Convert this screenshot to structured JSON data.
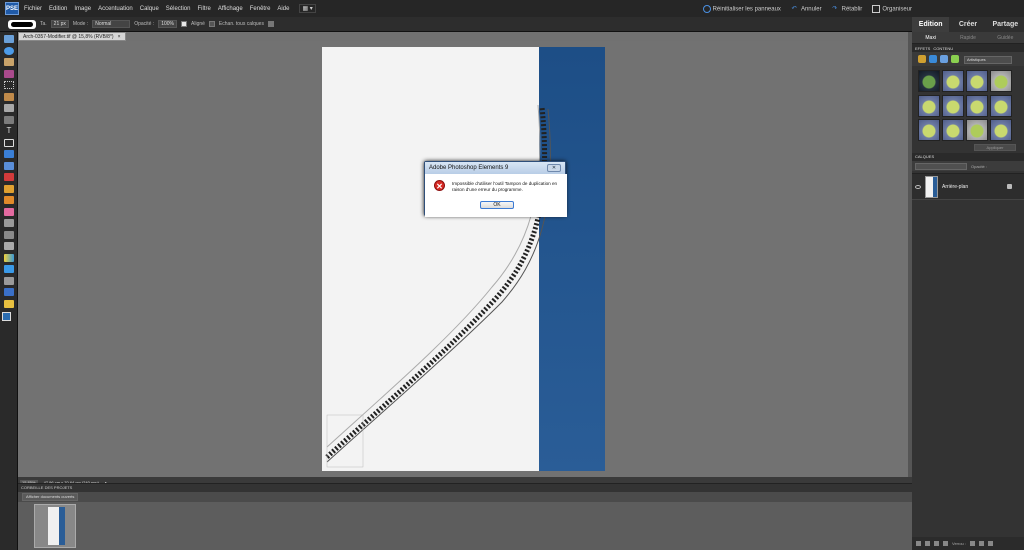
{
  "app": {
    "logo": "PSE"
  },
  "menu": {
    "items": [
      "Fichier",
      "Edition",
      "Image",
      "Accentuation",
      "Calque",
      "Sélection",
      "Filtre",
      "Affichage",
      "Fenêtre",
      "Aide"
    ]
  },
  "topright": {
    "reset_panels": "Réinitialiser les panneaux",
    "undo": "Annuler",
    "redo": "Rétablir",
    "organizer": "Organiseur"
  },
  "mode_tabs": [
    "Edition",
    "Créer",
    "Partage"
  ],
  "options": {
    "size_label": "Ta.",
    "size_value": "21 px",
    "mode_label": "Mode :",
    "mode_value": "Normal",
    "opacity_label": "Opacité :",
    "opacity_value": "100%",
    "aligned_label": "Aligné",
    "sample_all_label": "Echan. tous calques"
  },
  "document": {
    "tab_title": "Arch-0357-Modifier.tif @ 15,8% (RVB/8*)",
    "zoom": "15,85%",
    "dims": "47,96 cm x 70,64 cm (240 ppp)"
  },
  "project_bin": {
    "header": "CORBEILLE DES PROJETS",
    "dropdown": "Afficher documents ouverts"
  },
  "panel": {
    "subtabs": [
      "Maxi",
      "Rapide",
      "Guidée"
    ],
    "effects_tab": "EFFETS",
    "content_tab": "CONTENU",
    "artistic_dropdown": "Artistiques",
    "apply_button": "Appliquer",
    "layers_header": "CALQUES",
    "opacity_label": "Opacité :",
    "layer_name": "Arrière-plan",
    "lock_label": "Verrou :"
  },
  "dialog": {
    "title": "Adobe Photoshop Elements 9",
    "message": "Impossible d'utiliser l'outil Tampon de duplication en raison d'une erreur du programme.",
    "ok": "OK"
  },
  "colors": {
    "sky": "#2a5d97",
    "error": "#d72a24"
  }
}
